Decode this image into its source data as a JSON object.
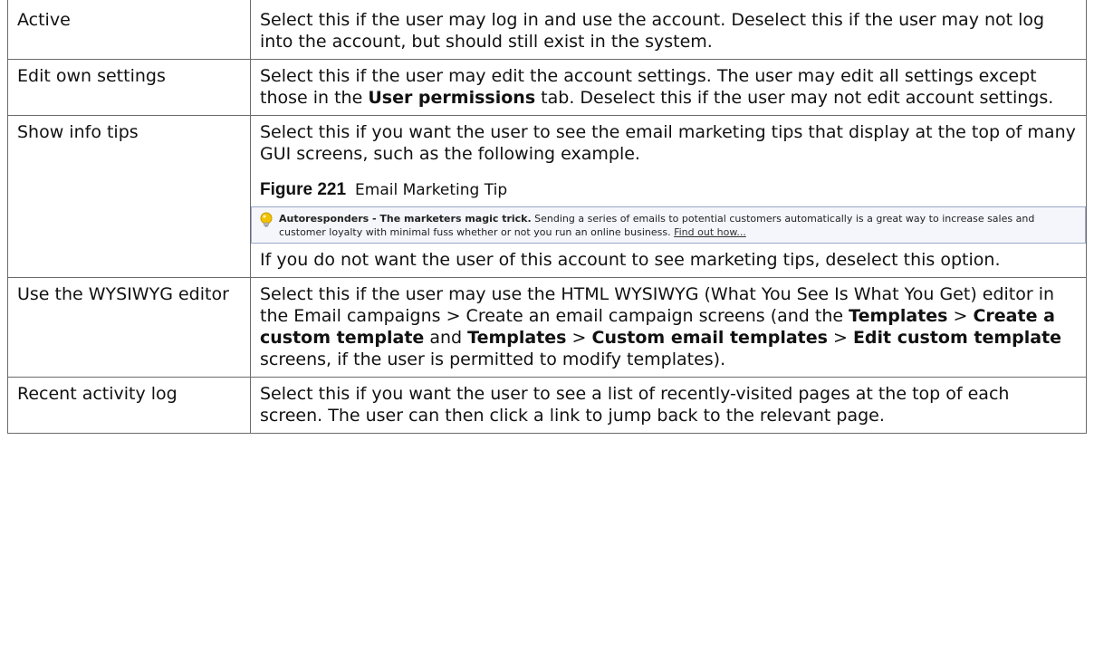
{
  "rows": [
    {
      "label": "Active",
      "desc": "Select this if the user may log in and use the account. Deselect this if the user may not log into the account, but should still exist in the system."
    },
    {
      "label": "Edit own settings",
      "desc_parts": [
        "Select this if the user may edit the account settings. The user may edit all settings except those in the ",
        "User permissions",
        " tab. Deselect this if the user may not edit account settings."
      ]
    },
    {
      "label": "Show info tips",
      "desc": "Select this if you want the user to see the email marketing tips that display at the top of many GUI screens, such as the following example.",
      "figure": {
        "number": "Figure 221",
        "caption": "Email Marketing Tip",
        "tip_title": "Autoresponders - The marketers magic trick.",
        "tip_text": " Sending a series of emails to potential customers automatically is a great way to increase sales and customer loyalty with minimal fuss whether or not you run an online business. ",
        "tip_link": "Find out how..."
      },
      "after": "If you do not want the user of this account to see marketing tips, deselect this option."
    },
    {
      "label": "Use the WYSIWYG editor",
      "desc_parts": [
        "Select this if the user may use the HTML WYSIWYG (What You See Is What You Get) editor in the Email campaigns > Create an email campaign screens (and the ",
        "Templates",
        " > ",
        "Create a custom template",
        " and ",
        "Templates",
        " > ",
        "Custom email templates",
        " > ",
        "Edit custom template",
        " screens, if the user is permitted to modify templates)."
      ]
    },
    {
      "label": "Recent activity log",
      "desc": "Select this if you want the user to see a list of recently-visited pages at the top of each screen. The user can then click a link to jump back to the relevant page."
    }
  ],
  "icons": {
    "tip_bulb": "lightbulb-icon"
  },
  "colors": {
    "border": "#6b6b6b",
    "tip_border": "#9aa7c8",
    "tip_bg": "#f4f6fb",
    "bulb": "#f2c200"
  }
}
